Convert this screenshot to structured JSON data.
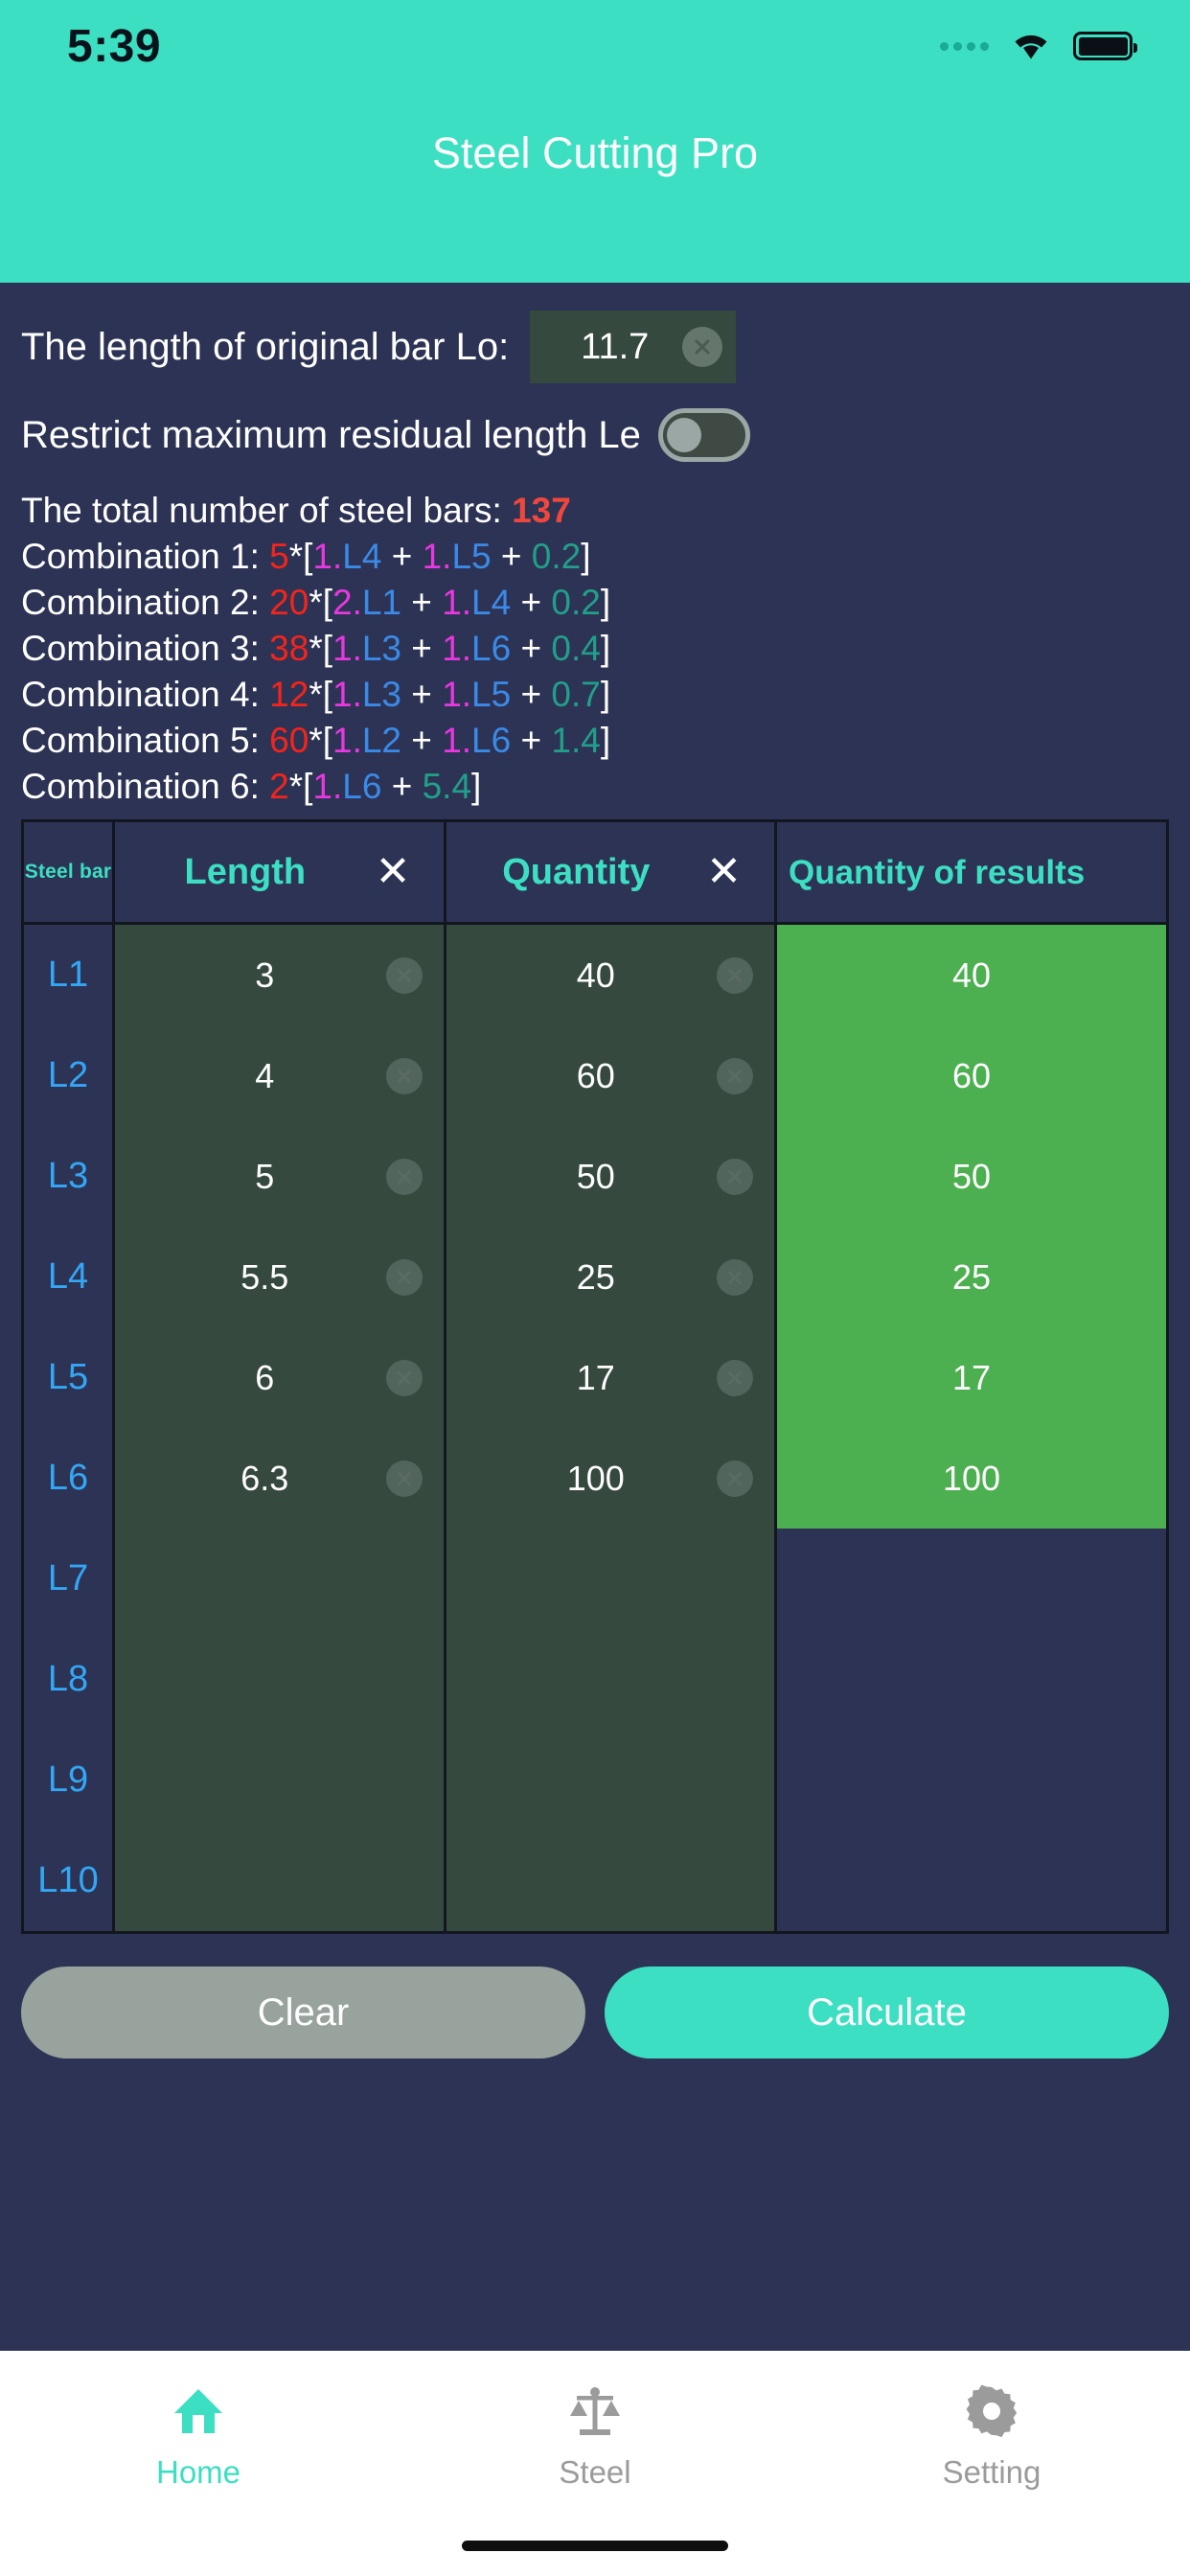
{
  "status_bar": {
    "time": "5:39",
    "signal_icon": "signal-dots-icon",
    "wifi_icon": "wifi-icon",
    "battery_icon": "battery-full-icon"
  },
  "header": {
    "app_title": "Steel Cutting Pro",
    "background_color": "#3cdfc2"
  },
  "inputs": {
    "lo_label": "The length of original bar Lo:",
    "lo_value": "11.7",
    "lo_clear_icon": "clear-circle-icon",
    "restrict_label": "Restrict maximum residual length Le",
    "restrict_toggle_state": "off"
  },
  "results": {
    "total_label": "The total number of steel bars:",
    "total_value": "137",
    "combinations": [
      {
        "label": "Combination 1:",
        "count": "5",
        "terms": [
          {
            "coef": "1.",
            "bar": "L4"
          },
          {
            "coef": "1.",
            "bar": "L5"
          }
        ],
        "remainder": "0.2"
      },
      {
        "label": "Combination 2:",
        "count": "20",
        "terms": [
          {
            "coef": "2.",
            "bar": "L1"
          },
          {
            "coef": "1.",
            "bar": "L4"
          }
        ],
        "remainder": "0.2"
      },
      {
        "label": "Combination 3:",
        "count": "38",
        "terms": [
          {
            "coef": "1.",
            "bar": "L3"
          },
          {
            "coef": "1.",
            "bar": "L6"
          }
        ],
        "remainder": "0.4"
      },
      {
        "label": "Combination 4:",
        "count": "12",
        "terms": [
          {
            "coef": "1.",
            "bar": "L3"
          },
          {
            "coef": "1.",
            "bar": "L5"
          }
        ],
        "remainder": "0.7"
      },
      {
        "label": "Combination 5:",
        "count": "60",
        "terms": [
          {
            "coef": "1.",
            "bar": "L2"
          },
          {
            "coef": "1.",
            "bar": "L6"
          }
        ],
        "remainder": "1.4"
      },
      {
        "label": "Combination 6:",
        "count": "2",
        "terms": [
          {
            "coef": "1.",
            "bar": "L6"
          }
        ],
        "remainder": "5.4"
      }
    ],
    "colors": {
      "count": "#f5241a",
      "coefficient": "#e838e0",
      "bar": "#3a8ae8",
      "remainder": "#21a089",
      "total": "#f0473c"
    }
  },
  "table": {
    "headers": {
      "steel_bar": "Steel bar",
      "length": "Length",
      "length_clear_icon": "x-icon",
      "quantity": "Quantity",
      "quantity_clear_icon": "x-icon",
      "results": "Quantity of results"
    },
    "rows": [
      {
        "bar": "L1",
        "length": "3",
        "quantity": "40",
        "result": "40"
      },
      {
        "bar": "L2",
        "length": "4",
        "quantity": "60",
        "result": "60"
      },
      {
        "bar": "L3",
        "length": "5",
        "quantity": "50",
        "result": "50"
      },
      {
        "bar": "L4",
        "length": "5.5",
        "quantity": "25",
        "result": "25"
      },
      {
        "bar": "L5",
        "length": "6",
        "quantity": "17",
        "result": "17"
      },
      {
        "bar": "L6",
        "length": "6.3",
        "quantity": "100",
        "result": "100"
      },
      {
        "bar": "L7",
        "length": "",
        "quantity": "",
        "result": ""
      },
      {
        "bar": "L8",
        "length": "",
        "quantity": "",
        "result": ""
      },
      {
        "bar": "L9",
        "length": "",
        "quantity": "",
        "result": ""
      },
      {
        "bar": "L10",
        "length": "",
        "quantity": "",
        "result": ""
      }
    ],
    "colors": {
      "bar_label": "#33a7f5",
      "header_text": "#3cdfc2",
      "result_filled": "#4caf50",
      "input_cell": "#35493f"
    }
  },
  "actions": {
    "clear_label": "Clear",
    "calculate_label": "Calculate",
    "clear_color": "#97a39c",
    "calculate_color": "#3cdfc2"
  },
  "tabbar": {
    "items": [
      {
        "label": "Home",
        "icon": "home-icon",
        "active": true
      },
      {
        "label": "Steel",
        "icon": "scale-icon",
        "active": false
      },
      {
        "label": "Setting",
        "icon": "gear-icon",
        "active": false
      }
    ],
    "active_color": "#3cdfc2",
    "idle_color": "#9b9b9b"
  }
}
